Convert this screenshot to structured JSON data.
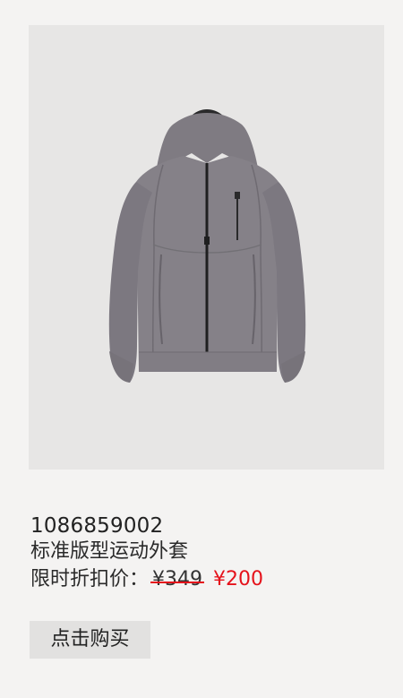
{
  "product": {
    "image_alt": "grey hooded zip jacket",
    "sku": "1086859002",
    "name": "标准版型运动外套",
    "price_label": "限时折扣价：",
    "original_price": "¥349",
    "sale_price": "¥200"
  },
  "actions": {
    "buy_label": "点击购买"
  },
  "colors": {
    "page_bg": "#f4f3f2",
    "image_bg": "#e7e6e5",
    "jacket": "#858188",
    "jacket_dark": "#6f6b72",
    "sale_red": "#e5121b",
    "button_bg": "#e2e1e0"
  }
}
